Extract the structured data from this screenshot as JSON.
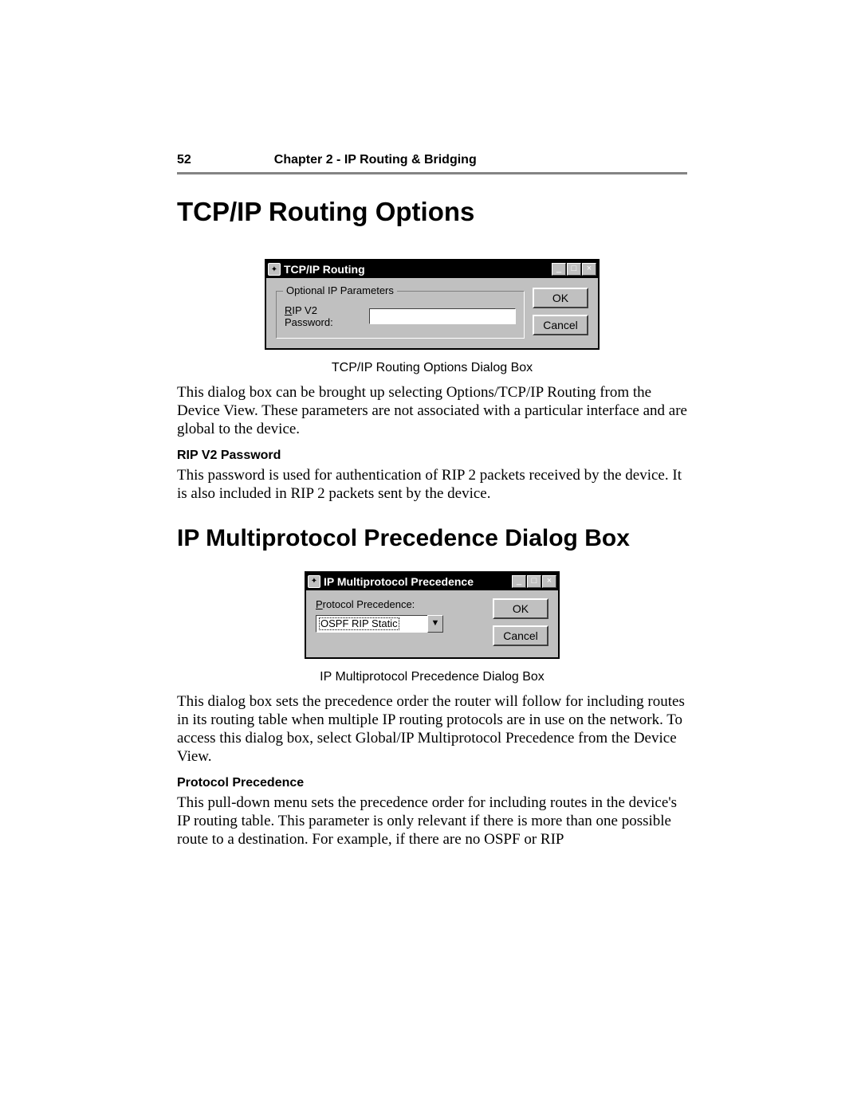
{
  "header": {
    "page_number": "52",
    "chapter": "Chapter 2 - IP Routing & Bridging"
  },
  "section1": {
    "title": "TCP/IP Routing Options",
    "caption": "TCP/IP Routing Options Dialog Box",
    "body1": "This dialog box can be brought up selecting Options/TCP/IP Routing from the Device View. These parameters are not associated with a particular interface and are global to the device.",
    "subhead": "RIP V2 Password",
    "body2": "This password is used for authentication of RIP 2 packets received by the device. It is also included in RIP 2 packets sent by the device."
  },
  "dialog1": {
    "title": "TCP/IP Routing",
    "groupbox_legend": "Optional IP Parameters",
    "field_label_pre": "R",
    "field_label_rest": "IP V2 Password:",
    "field_value": "",
    "ok_label": "OK",
    "cancel_label": "Cancel",
    "min_icon": "_",
    "max_icon": "□",
    "close_icon": "×"
  },
  "section2": {
    "title": "IP Multiprotocol Precedence Dialog Box",
    "caption": "IP Multiprotocol Precedence Dialog Box",
    "body1": "This dialog box sets the precedence order the router will follow for including routes in its routing table when multiple IP routing protocols are in use on the network. To access this dialog box, select Global/IP Multiprotocol Precedence from the Device View.",
    "subhead": "Protocol Precedence",
    "body2": "This pull-down menu sets the precedence order for including routes in the device's IP routing table. This parameter is only relevant if there is more than one possible route to a destination. For example, if there are no OSPF or RIP"
  },
  "dialog2": {
    "title": "IP Multiprotocol Precedence",
    "label_pre": "P",
    "label_rest": "rotocol Precedence:",
    "selected_value": "OSPF RIP Static",
    "dropdown_glyph": "▼",
    "ok_label": "OK",
    "cancel_label": "Cancel",
    "min_icon": "_",
    "max_icon": "□",
    "close_icon": "×"
  }
}
